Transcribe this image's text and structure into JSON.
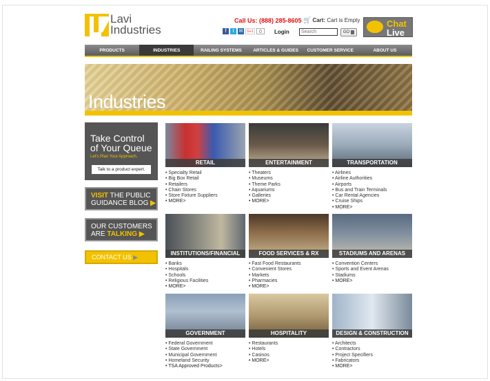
{
  "header": {
    "logo_line1": "Lavi",
    "logo_line2": "Industries",
    "call_label": "Call Us: (888) 285-8605",
    "cart_label": "Cart:",
    "cart_status": "Cart is Empty",
    "login_label": "Login",
    "search_placeholder": "Search",
    "go_label": "GO",
    "chat_line1": "Chat",
    "chat_line2": "Live",
    "social": {
      "facebook": "f",
      "twitter": "t",
      "email": "✉",
      "gplus": "G+1",
      "count": "0"
    }
  },
  "nav": [
    "PRODUCTS",
    "INDUSTRIES",
    "RAILING SYSTEMS",
    "ARTICLES & GUIDES",
    "CUSTOMER SERVICE",
    "ABOUT US"
  ],
  "nav_active_index": 1,
  "banner": {
    "title": "Industries"
  },
  "sidebar": {
    "queue_title_line1": "Take Control",
    "queue_title_line2": "of Your Queue",
    "queue_sub": "Let's Plan Your Approach.",
    "queue_button": "Talk to a product expert.",
    "blog_hl": "VISIT",
    "blog_line1": "THE PUBLIC",
    "blog_line2": "GUIDANCE BLOG",
    "customers_line1": "OUR CUSTOMERS",
    "customers_line2": "ARE",
    "customers_hl": "TALKING",
    "contact": "CONTACT US"
  },
  "industries": [
    {
      "title": "RETAIL",
      "items": [
        "Specialty Retail",
        "Big Box Retail",
        "Retailers",
        "Chain Stores",
        "Store Fixture Suppliers",
        "MORE>"
      ]
    },
    {
      "title": "ENTERTAINMENT",
      "items": [
        "Theaters",
        "Museums",
        "Theme Parks",
        "Aquariums",
        "Galleries",
        "MORE>"
      ]
    },
    {
      "title": "TRANSPORTATION",
      "items": [
        "Airlines",
        "Airline Authorities",
        "Airports",
        "Bus and Train Terminals",
        "Car Rental Agencies",
        "Cruise Ships",
        "MORE>"
      ]
    },
    {
      "title": "INSTITUTIONS/FINANCIAL",
      "items": [
        "Banks",
        "Hospitals",
        "Schools",
        "Religious Facilities",
        "MORE>"
      ]
    },
    {
      "title": "FOOD SERVICES & RX",
      "items": [
        "Fast Food Restaurants",
        "Convenient Stores",
        "Markets",
        "Pharmacies",
        "MORE>"
      ]
    },
    {
      "title": "STADIUMS AND ARENAS",
      "items": [
        "Convention Centers",
        "Sports and Event Arenas",
        "Stadiums",
        "MORE>"
      ]
    },
    {
      "title": "GOVERNMENT",
      "items": [
        "Federal Government",
        "State Government",
        "Municipal Government",
        "Homeland Security",
        "TSA Approved Products>"
      ]
    },
    {
      "title": "HOSPITALITY",
      "items": [
        "Restaurants",
        "Hotels",
        "Casinos",
        "MORE>"
      ]
    },
    {
      "title": "DESIGN & CONSTRUCTION",
      "items": [
        "Architects",
        "Contractors",
        "Project Specifiers",
        "Fabricators",
        "MORE>"
      ]
    }
  ],
  "colors": {
    "brand_yellow": "#f2c200",
    "nav_gray": "#5c5c5c",
    "call_red": "#dd1111"
  }
}
